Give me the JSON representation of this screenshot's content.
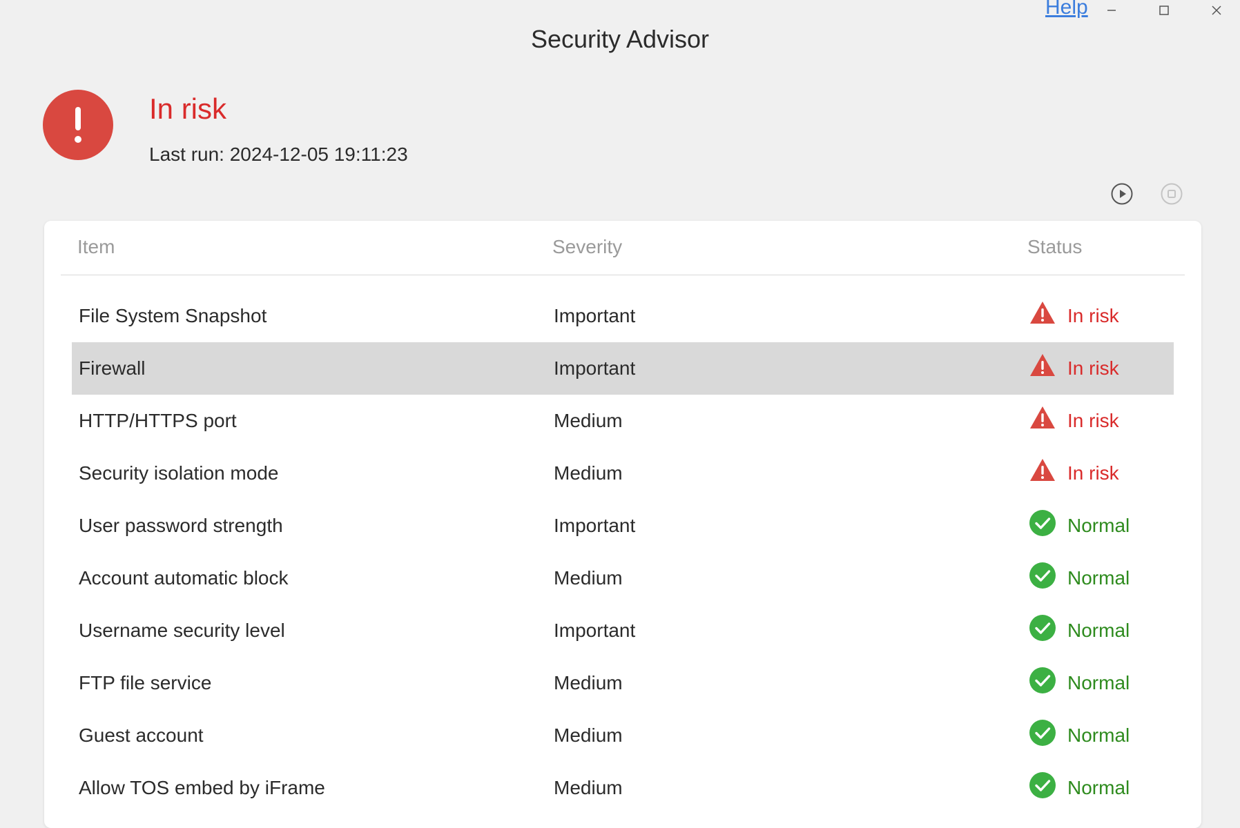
{
  "window": {
    "title": "Security Advisor",
    "help_label": "Help"
  },
  "summary": {
    "status": "In risk",
    "last_run": "Last run: 2024-12-05 19:11:23"
  },
  "table": {
    "headers": {
      "item": "Item",
      "severity": "Severity",
      "status": "Status"
    },
    "rows": [
      {
        "item": "File System Snapshot",
        "severity": "Important",
        "status": "In risk",
        "icon": "warning-icon"
      },
      {
        "item": "Firewall",
        "severity": "Important",
        "status": "In risk",
        "icon": "warning-icon",
        "selected": true
      },
      {
        "item": "HTTP/HTTPS port",
        "severity": "Medium",
        "status": "In risk",
        "icon": "warning-icon"
      },
      {
        "item": "Security isolation mode",
        "severity": "Medium",
        "status": "In risk",
        "icon": "warning-icon"
      },
      {
        "item": "User password strength",
        "severity": "Important",
        "status": "Normal",
        "icon": "check-circle-icon"
      },
      {
        "item": "Account automatic block",
        "severity": "Medium",
        "status": "Normal",
        "icon": "check-circle-icon"
      },
      {
        "item": "Username security level",
        "severity": "Important",
        "status": "Normal",
        "icon": "check-circle-icon"
      },
      {
        "item": "FTP file service",
        "severity": "Medium",
        "status": "Normal",
        "icon": "check-circle-icon"
      },
      {
        "item": "Guest account",
        "severity": "Medium",
        "status": "Normal",
        "icon": "check-circle-icon"
      },
      {
        "item": "Allow TOS embed by iFrame",
        "severity": "Medium",
        "status": "Normal",
        "icon": "check-circle-icon"
      }
    ]
  },
  "colors": {
    "risk": "#d92b2b",
    "normal": "#2e8b1e",
    "risk_icon": "#d94840",
    "normal_icon": "#3cb043",
    "link": "#3b7ddd"
  }
}
